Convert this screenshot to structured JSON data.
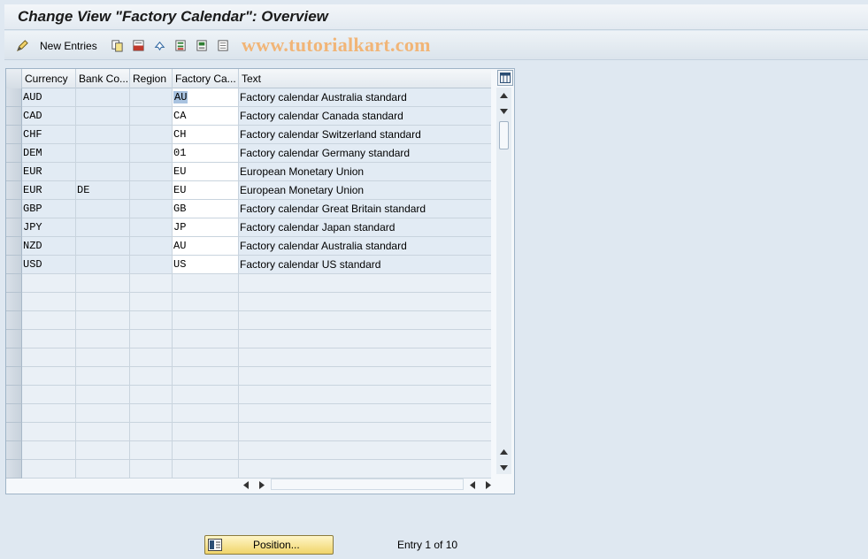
{
  "window": {
    "title": "Change View \"Factory Calendar\": Overview"
  },
  "toolbar": {
    "new_entries_label": "New Entries",
    "watermark": "www.tutorialkart.com",
    "icons": [
      "pencil-glasses-icon",
      "copy-icon",
      "delete-icon",
      "undo-icon",
      "select-all-icon",
      "select-block-icon",
      "deselect-all-icon"
    ]
  },
  "table": {
    "columns": [
      "Currency",
      "Bank Co...",
      "Region",
      "Factory Ca...",
      "Text"
    ],
    "rows": [
      {
        "currency": "AUD",
        "bank_country": "",
        "region": "",
        "factory_calendar": "AU",
        "text": "Factory calendar Australia standard"
      },
      {
        "currency": "CAD",
        "bank_country": "",
        "region": "",
        "factory_calendar": "CA",
        "text": "Factory calendar Canada standard"
      },
      {
        "currency": "CHF",
        "bank_country": "",
        "region": "",
        "factory_calendar": "CH",
        "text": "Factory calendar Switzerland standard"
      },
      {
        "currency": "DEM",
        "bank_country": "",
        "region": "",
        "factory_calendar": "01",
        "text": "Factory calendar Germany standard"
      },
      {
        "currency": "EUR",
        "bank_country": "",
        "region": "",
        "factory_calendar": "EU",
        "text": "European Monetary Union"
      },
      {
        "currency": "EUR",
        "bank_country": "DE",
        "region": "",
        "factory_calendar": "EU",
        "text": "European Monetary Union"
      },
      {
        "currency": "GBP",
        "bank_country": "",
        "region": "",
        "factory_calendar": "GB",
        "text": "Factory calendar Great Britain standard"
      },
      {
        "currency": "JPY",
        "bank_country": "",
        "region": "",
        "factory_calendar": "JP",
        "text": "Factory calendar Japan standard"
      },
      {
        "currency": "NZD",
        "bank_country": "",
        "region": "",
        "factory_calendar": "AU",
        "text": "Factory calendar Australia standard"
      },
      {
        "currency": "USD",
        "bank_country": "",
        "region": "",
        "factory_calendar": "US",
        "text": "Factory calendar US standard"
      }
    ],
    "empty_rows": 11
  },
  "footer": {
    "position_label": "Position...",
    "entry_info": "Entry 1 of 10"
  },
  "colors": {
    "background": "#dfe8f1",
    "readonly_cell": "#e2ebf4",
    "editable_cell": "#ffffff",
    "watermark": "#f1b577",
    "button": "#f0d46a"
  }
}
